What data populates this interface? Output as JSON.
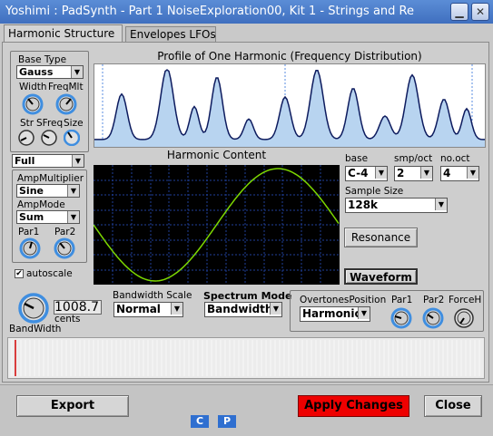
{
  "window": {
    "title": "Yoshimi : PadSynth - Part 1 NoiseExploration00, Kit 1 - Strings and Re",
    "minimize_glyph": "▁",
    "close_glyph": "✕"
  },
  "tabs": [
    {
      "label": "Harmonic Structure",
      "active": true
    },
    {
      "label": "Envelopes LFOs",
      "active": false
    }
  ],
  "base_type": {
    "label": "Base Type",
    "value": "Gauss"
  },
  "knob_labels": {
    "width": "Width",
    "freqmlt": "FreqMlt",
    "str": "Str",
    "sfreq": "SFreq",
    "size": "Size"
  },
  "full_combo": {
    "value": "Full"
  },
  "amp_multiplier": {
    "label": "AmpMultiplier",
    "value": "Sine"
  },
  "amp_mode": {
    "label": "AmpMode",
    "value": "Sum"
  },
  "par_labels": {
    "par1": "Par1",
    "par2": "Par2"
  },
  "autoscale": {
    "label": "autoscale",
    "checked": true
  },
  "profile": {
    "title": "Profile of One Harmonic (Frequency Distribution)"
  },
  "harmonic_content": {
    "title": "Harmonic Content"
  },
  "base_note": {
    "label": "base",
    "value": "C-4"
  },
  "smp_oct": {
    "label": "smp/oct",
    "value": "2"
  },
  "no_oct": {
    "label": "no.oct",
    "value": "4"
  },
  "sample_size": {
    "label": "Sample Size",
    "value": "128k"
  },
  "resonance_button": "Resonance",
  "waveform_button": "Waveform",
  "bandwidth": {
    "value": "1008.7",
    "unit": "cents",
    "label": "BandWidth"
  },
  "bandwidth_scale": {
    "label": "Bandwidth Scale",
    "value": "Normal"
  },
  "spectrum_mode": {
    "label": "Spectrum Mode",
    "value": "Bandwidth"
  },
  "overtones": {
    "label": "OvertonesPosition",
    "value": "Harmonic",
    "par1": "Par1",
    "par2": "Par2",
    "forceh": "ForceH"
  },
  "footer": {
    "export_label": "Export",
    "apply_label": "Apply Changes",
    "close_label": "Close",
    "c_label": "C",
    "p_label": "P"
  },
  "colors": {
    "title_bar": "#4a7bc8",
    "profile_fill": "#b8d4f0",
    "profile_line": "#0d1b5e",
    "harmonic_wave": "#7dd800",
    "harmonic_grid": "#1f3f9a",
    "apply_button": "#ee0000",
    "knob_ring": "#3f8ee0"
  }
}
